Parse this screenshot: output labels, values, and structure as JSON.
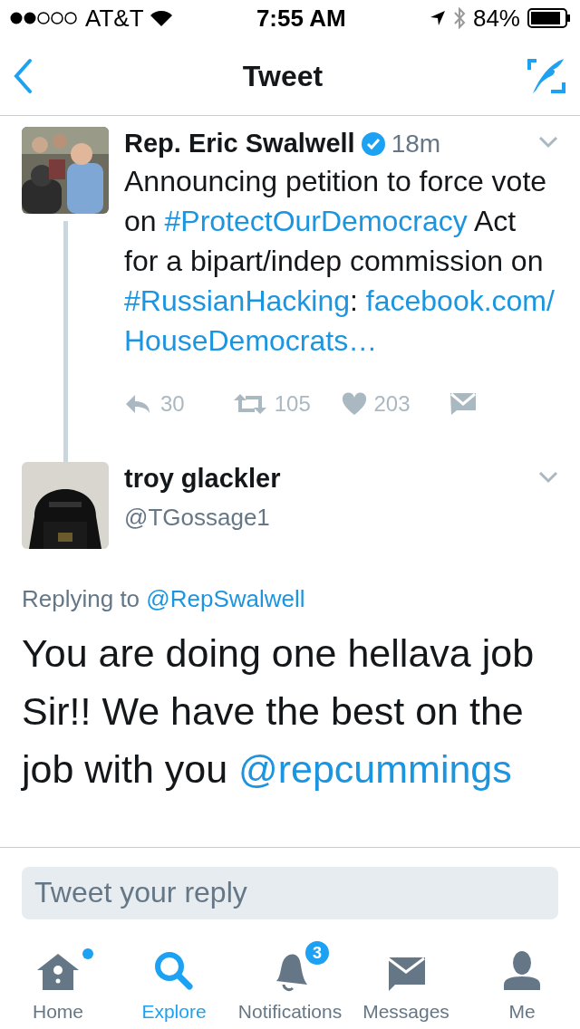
{
  "status_bar": {
    "carrier": "AT&T",
    "time": "7:55 AM",
    "battery": "84%"
  },
  "nav": {
    "title": "Tweet"
  },
  "tweets": [
    {
      "name": "Rep. Eric Swalwell",
      "verified": true,
      "time": "18m",
      "thread_line": true,
      "text": [
        {
          "kind": "text",
          "text": "Announcing petition to force vote on "
        },
        {
          "kind": "link",
          "text": "#ProtectOurDemocracy"
        },
        {
          "kind": "text",
          "text": " Act for a bipart/indep commission on "
        },
        {
          "kind": "link",
          "text": "#RussianHacking"
        },
        {
          "kind": "text",
          "text": ": "
        },
        {
          "kind": "link",
          "text": "facebook.com/"
        },
        {
          "kind": "link",
          "text": "HouseDemocrats…"
        }
      ],
      "actions": [
        {
          "kind": "reply",
          "count": "30"
        },
        {
          "kind": "retweet",
          "count": "105"
        },
        {
          "kind": "like",
          "count": "203"
        },
        {
          "kind": "dm"
        }
      ]
    },
    {
      "name": "troy glackler",
      "handle": "@TGossage1",
      "verified": false,
      "thread_line": false,
      "replying_to": {
        "label": "Replying to",
        "user": "@RepSwalwell"
      },
      "big_text": [
        {
          "kind": "text",
          "text": "You are doing one hellava job Sir!! We have the best on the job with you "
        },
        {
          "kind": "link",
          "text": "@repcummings"
        }
      ]
    }
  ],
  "reply_box": {
    "placeholder": "Tweet your reply"
  },
  "tabs": [
    {
      "label": "Home",
      "kind": "home",
      "selected": false,
      "dot": true
    },
    {
      "label": "Explore",
      "kind": "search",
      "selected": true,
      "dot": false
    },
    {
      "label": "Notifications",
      "kind": "bell",
      "selected": false,
      "dot": false,
      "badge": "3"
    },
    {
      "label": "Messages",
      "kind": "mail",
      "selected": false,
      "dot": false
    },
    {
      "label": "Me",
      "kind": "person",
      "selected": false,
      "dot": false
    }
  ]
}
